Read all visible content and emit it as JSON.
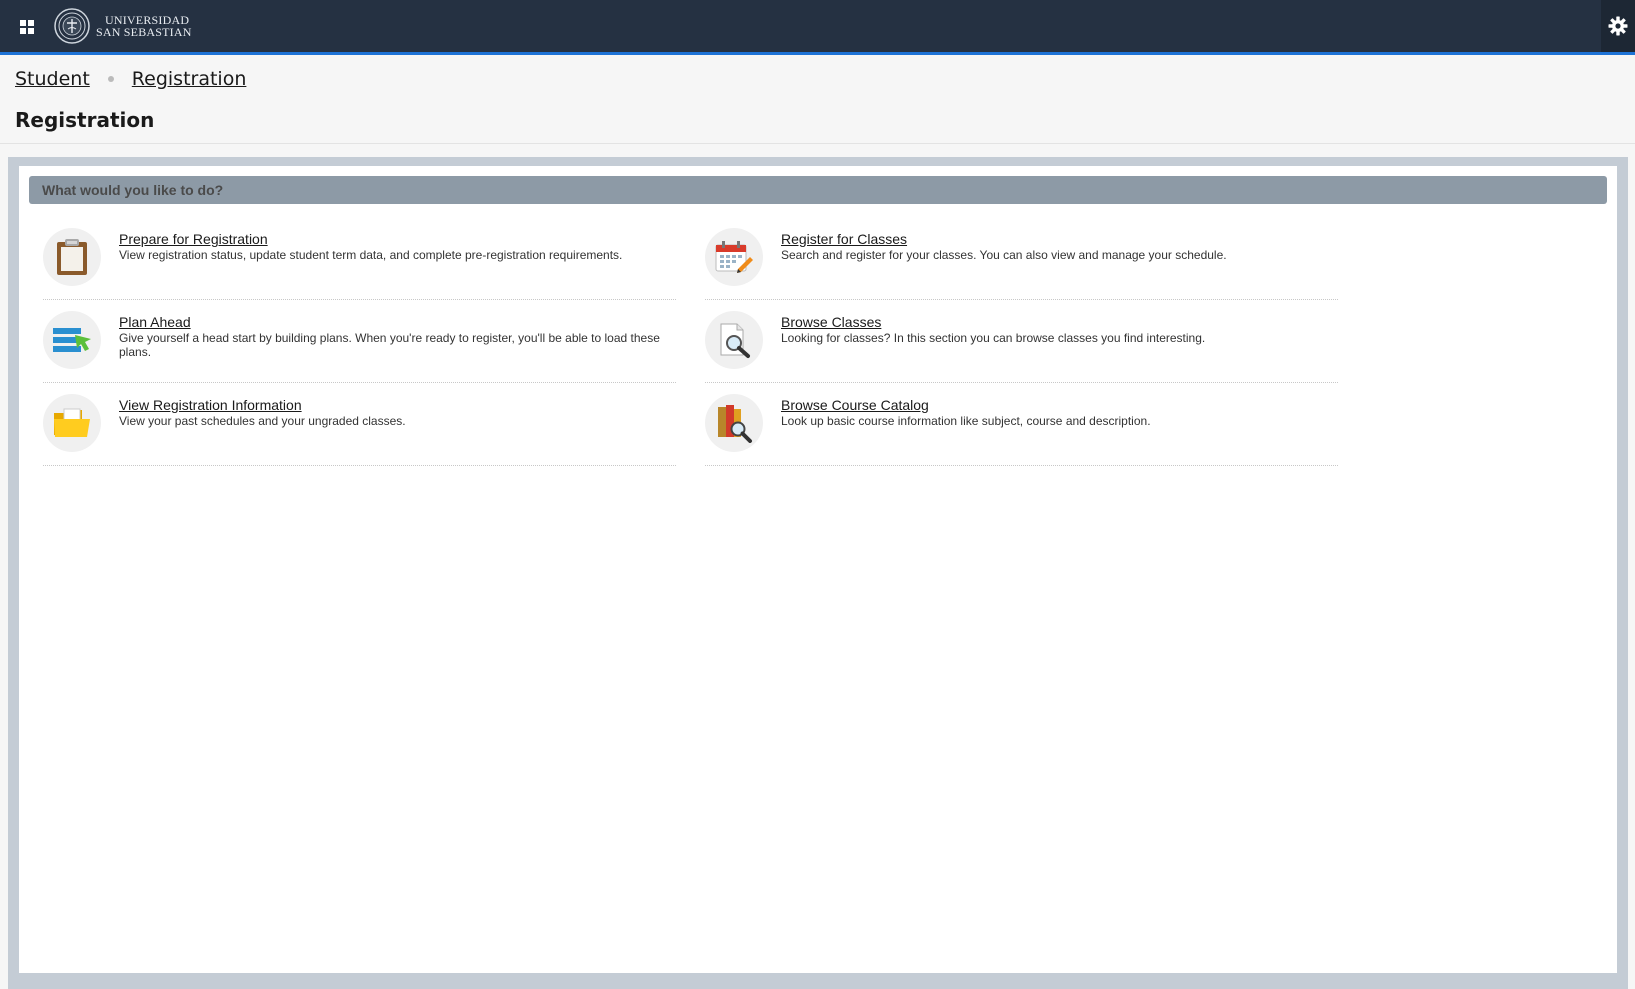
{
  "header": {
    "logo_line1": "UNIVERSIDAD",
    "logo_line2": "SAN SEBASTIAN",
    "apps_icon": "grid-apps-icon",
    "settings_icon": "gear-icon",
    "accent_color": "#1e73d6",
    "bar_color": "#253142"
  },
  "breadcrumb": [
    "Student",
    "Registration"
  ],
  "page_title": "Registration",
  "section": {
    "header": "What would you like to do?",
    "options": [
      {
        "title": "Prepare for Registration",
        "description": "View registration status, update student term data, and complete pre-registration requirements.",
        "icon": "clipboard-icon"
      },
      {
        "title": "Register for Classes",
        "description": "Search and register for your classes. You can also view and manage your schedule.",
        "icon": "calendar-pencil-icon"
      },
      {
        "title": "Plan Ahead",
        "description": "Give yourself a head start by building plans. When you're ready to register, you'll be able to load these plans.",
        "icon": "plan-list-arrow-icon"
      },
      {
        "title": "Browse Classes",
        "description": "Looking for classes? In this section you can browse classes you find interesting.",
        "icon": "document-search-icon"
      },
      {
        "title": "View Registration Information",
        "description": "View your past schedules and your ungraded classes.",
        "icon": "folder-icon"
      },
      {
        "title": "Browse Course Catalog",
        "description": "Look up basic course information like subject, course and description.",
        "icon": "books-search-icon"
      }
    ]
  }
}
